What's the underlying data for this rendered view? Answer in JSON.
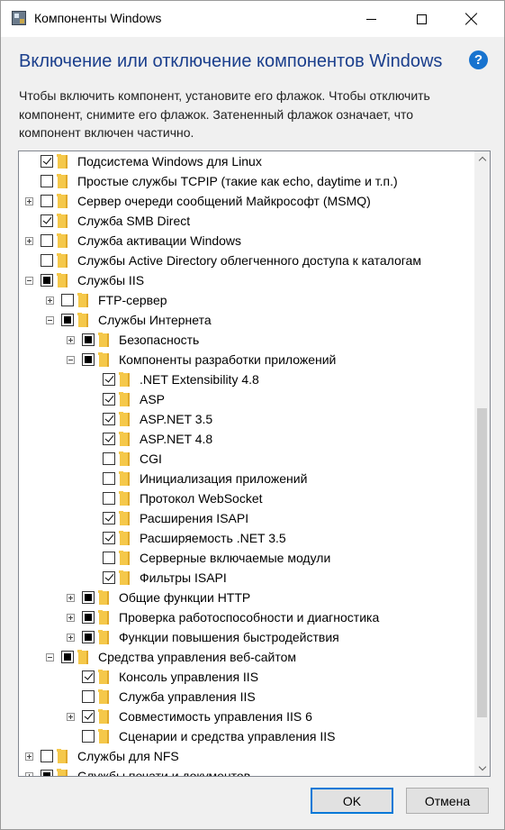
{
  "window": {
    "title": "Компоненты Windows",
    "heading": "Включение или отключение компонентов Windows",
    "help": "?",
    "description": "Чтобы включить компонент, установите его флажок. Чтобы отключить компонент, снимите его флажок. Затененный флажок означает, что компонент включен частично."
  },
  "tree": [
    {
      "label": "Подсистема Windows для Linux",
      "state": "checked",
      "expander": "none",
      "level": 0
    },
    {
      "label": "Простые службы TCPIP (такие как echo, daytime и т.п.)",
      "state": "unchecked",
      "expander": "none",
      "level": 0
    },
    {
      "label": "Сервер очереди сообщений Майкрософт (MSMQ)",
      "state": "unchecked",
      "expander": "plus",
      "level": 0
    },
    {
      "label": "Служба SMB Direct",
      "state": "checked",
      "expander": "none",
      "level": 0
    },
    {
      "label": "Служба активации Windows",
      "state": "unchecked",
      "expander": "plus",
      "level": 0
    },
    {
      "label": "Службы Active Directory облегченного доступа к каталогам",
      "state": "unchecked",
      "expander": "none",
      "level": 0
    },
    {
      "label": "Службы IIS",
      "state": "partial",
      "expander": "minus",
      "level": 0
    },
    {
      "label": "FTP-сервер",
      "state": "unchecked",
      "expander": "plus",
      "level": 1
    },
    {
      "label": "Службы Интернета",
      "state": "partial",
      "expander": "minus",
      "level": 1
    },
    {
      "label": "Безопасность",
      "state": "partial",
      "expander": "plus",
      "level": 2
    },
    {
      "label": "Компоненты разработки приложений",
      "state": "partial",
      "expander": "minus",
      "level": 2
    },
    {
      "label": ".NET Extensibility 4.8",
      "state": "checked",
      "expander": "none",
      "level": 3
    },
    {
      "label": "ASP",
      "state": "checked",
      "expander": "none",
      "level": 3
    },
    {
      "label": "ASP.NET 3.5",
      "state": "checked",
      "expander": "none",
      "level": 3
    },
    {
      "label": "ASP.NET 4.8",
      "state": "checked",
      "expander": "none",
      "level": 3
    },
    {
      "label": "CGI",
      "state": "unchecked",
      "expander": "none",
      "level": 3
    },
    {
      "label": "Инициализация приложений",
      "state": "unchecked",
      "expander": "none",
      "level": 3
    },
    {
      "label": "Протокол WebSocket",
      "state": "unchecked",
      "expander": "none",
      "level": 3
    },
    {
      "label": "Расширения ISAPI",
      "state": "checked",
      "expander": "none",
      "level": 3
    },
    {
      "label": "Расширяемость .NET 3.5",
      "state": "checked",
      "expander": "none",
      "level": 3
    },
    {
      "label": "Серверные включаемые модули",
      "state": "unchecked",
      "expander": "none",
      "level": 3
    },
    {
      "label": "Фильтры ISAPI",
      "state": "checked",
      "expander": "none",
      "level": 3
    },
    {
      "label": "Общие функции HTTP",
      "state": "partial",
      "expander": "plus",
      "level": 2
    },
    {
      "label": "Проверка работоспособности и диагностика",
      "state": "partial",
      "expander": "plus",
      "level": 2
    },
    {
      "label": "Функции повышения быстродействия",
      "state": "partial",
      "expander": "plus",
      "level": 2
    },
    {
      "label": "Средства управления веб-сайтом",
      "state": "partial",
      "expander": "minus",
      "level": 1
    },
    {
      "label": "Консоль управления IIS",
      "state": "checked",
      "expander": "none",
      "level": 2
    },
    {
      "label": "Служба управления IIS",
      "state": "unchecked",
      "expander": "none",
      "level": 2
    },
    {
      "label": "Совместимость управления IIS 6",
      "state": "checked",
      "expander": "plus",
      "level": 2
    },
    {
      "label": "Сценарии и средства управления IIS",
      "state": "unchecked",
      "expander": "none",
      "level": 2
    },
    {
      "label": "Службы для NFS",
      "state": "unchecked",
      "expander": "plus",
      "level": 0
    },
    {
      "label": "Службы печати и документов",
      "state": "partial",
      "expander": "plus",
      "level": 0
    }
  ],
  "buttons": {
    "ok": "OK",
    "cancel": "Отмена"
  },
  "icons": {
    "app": "windows-features-icon",
    "help": "help-icon",
    "folder": "folder-icon"
  }
}
